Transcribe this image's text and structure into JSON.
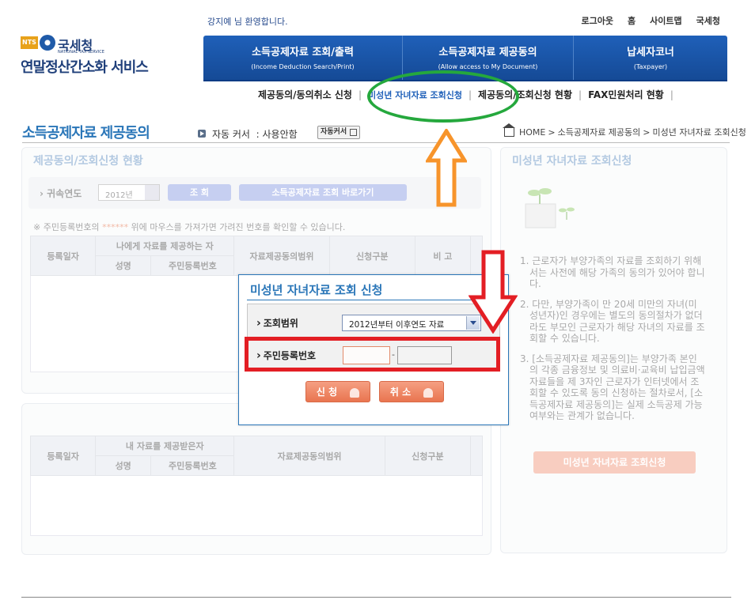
{
  "header": {
    "welcome": "강지예 님 환영합니다.",
    "top_links": [
      "로그아웃",
      "홈",
      "사이트맵",
      "국세청"
    ],
    "logo": {
      "org": "국세청",
      "org_en": "NATIONAL TAX SERVICE",
      "nts": "NTS",
      "service": "연말정산간소화 서비스"
    }
  },
  "main_nav": [
    {
      "title": "소득공제자료 조회/출력",
      "subtitle": "(Income Deduction Search/Print)"
    },
    {
      "title": "소득공제자료 제공동의",
      "subtitle": "(Allow access to My Document)"
    },
    {
      "title": "납세자코너",
      "subtitle": "(Taxpayer)"
    }
  ],
  "sub_nav": [
    "제공동의/동의취소 신청",
    "미성년 자녀자료 조회신청",
    "제공동의/조회신청 현황",
    "FAX민원처리 현황"
  ],
  "page": {
    "title": "소득공제자료 제공동의",
    "cursor_label": "자동 커서",
    "cursor_value": "사용안함",
    "cursor_button": "자동커서",
    "breadcrumb": [
      "HOME",
      "소득공제자료 제공동의",
      "미성년 자녀자료 조회신청"
    ]
  },
  "left_panel": {
    "title": "제공동의/조회신청 현황",
    "filter_label": "귀속연도",
    "filter_year": "2012년",
    "search_button": "조 회",
    "shortcut_button": "소득공제자료 조회 바로가기",
    "notice_prefix": "※ 주민등록번호의 ",
    "notice_star": "******",
    "notice_suffix": " 위에 마우스를 가져가면 가려진 번호를 확인할 수 있습니다.",
    "table1_headers": {
      "date": "등록일자",
      "group": "나에게 자료를 제공하는 자",
      "name": "성명",
      "rrn": "주민등록번호",
      "scope": "자료제공동의범위",
      "type": "신청구분",
      "note": "비 고"
    },
    "table2_headers": {
      "date": "등록일자",
      "group": "내 자료를 제공받은자",
      "name": "성명",
      "rrn": "주민등록번호",
      "scope": "자료제공동의범위",
      "type": "신청구분"
    }
  },
  "right_panel": {
    "title": "미성년 자녀자료 조회신청",
    "items": [
      "1. 근로자가 부양가족의 자료를 조회하기 위해서는 사전에 해당 가족의 동의가 있어야 합니다.",
      "2. 다만, 부양가족이 만 20세 미만의 자녀(미성년자)인 경우에는 별도의 동의절차가 없더라도 부모인 근로자가 해당 자녀의 자료를 조회할 수 있습니다.",
      "3. [소득공제자료 제공동의]는 부양가족 본인의 각종 금융정보 및 의료비·교육비 납입금액 자료들을 제 3자인 근로자가 인터넷에서 조회할 수 있도록 동의 신청하는 절차로서, [소득공제자료 제공동의]는 실제 소득공제 가능여부와는 관계가 없습니다."
    ],
    "button": "미성년 자녀자료 조회신청"
  },
  "dialog": {
    "title": "미성년 자녀자료 조회 신청",
    "scope_label": "조회범위",
    "scope_value": "2012년부터 이후연도 자료",
    "rrn_label": "주민등록번호",
    "rrn_dash": "-",
    "apply_button": "신 청",
    "cancel_button": "취 소"
  },
  "colors": {
    "nav_blue": "#1f60b9",
    "title_blue": "#2a76b8",
    "highlight_green": "#25a83d",
    "highlight_orange": "#f7942b",
    "highlight_red": "#e31e24",
    "button_coral": "#eb7a56"
  },
  "icons": [
    "home-icon",
    "arrow-up-annotation-icon",
    "arrow-down-annotation-icon",
    "sprout-icon"
  ]
}
